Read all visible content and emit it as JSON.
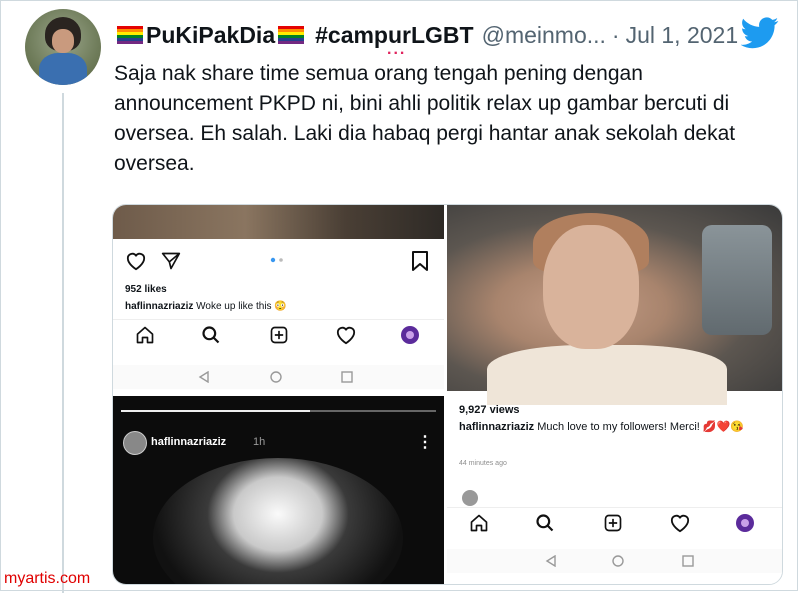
{
  "tweet": {
    "display_name": "PuKiPakDia",
    "hashtag": "#campurLGBT",
    "handle": "@meinmo...",
    "separator": "·",
    "date": "Jul 1, 2021",
    "text": "Saja nak share time semua orang tengah pening dengan announcement PKPD ni, bini ahli politik relax up gambar bercuti di oversea. Eh salah. Laki dia habaq pergi hantar anak sekolah dekat oversea.",
    "more_glyph": "..."
  },
  "post1": {
    "likes": "952 likes",
    "caption_user": "haflinnazriaziz",
    "caption_text": "Woke up like this 😳"
  },
  "post2": {
    "views": "9,927 views",
    "caption_user": "haflinnazriaziz",
    "caption_text": "Much love to my followers! Merci! 💋❤️😘",
    "time_ago": "44 minutes ago"
  },
  "story": {
    "username": "haflinnazriaziz",
    "time": "1h",
    "menu_glyph": "⋮"
  },
  "icons": [
    "twitter-bird-icon",
    "heart-icon",
    "send-icon",
    "bookmark-icon",
    "home-icon",
    "search-icon",
    "add-post-icon",
    "activity-heart-icon",
    "profile-avatar-icon",
    "back-triangle-icon",
    "home-circle-icon",
    "recents-square-icon"
  ],
  "colors": {
    "twitter_blue": "#1d9bf0",
    "muted": "#536471",
    "watermark": "#e00000",
    "ig_purple": "#5b2b9b"
  },
  "watermark": "myartis.com"
}
